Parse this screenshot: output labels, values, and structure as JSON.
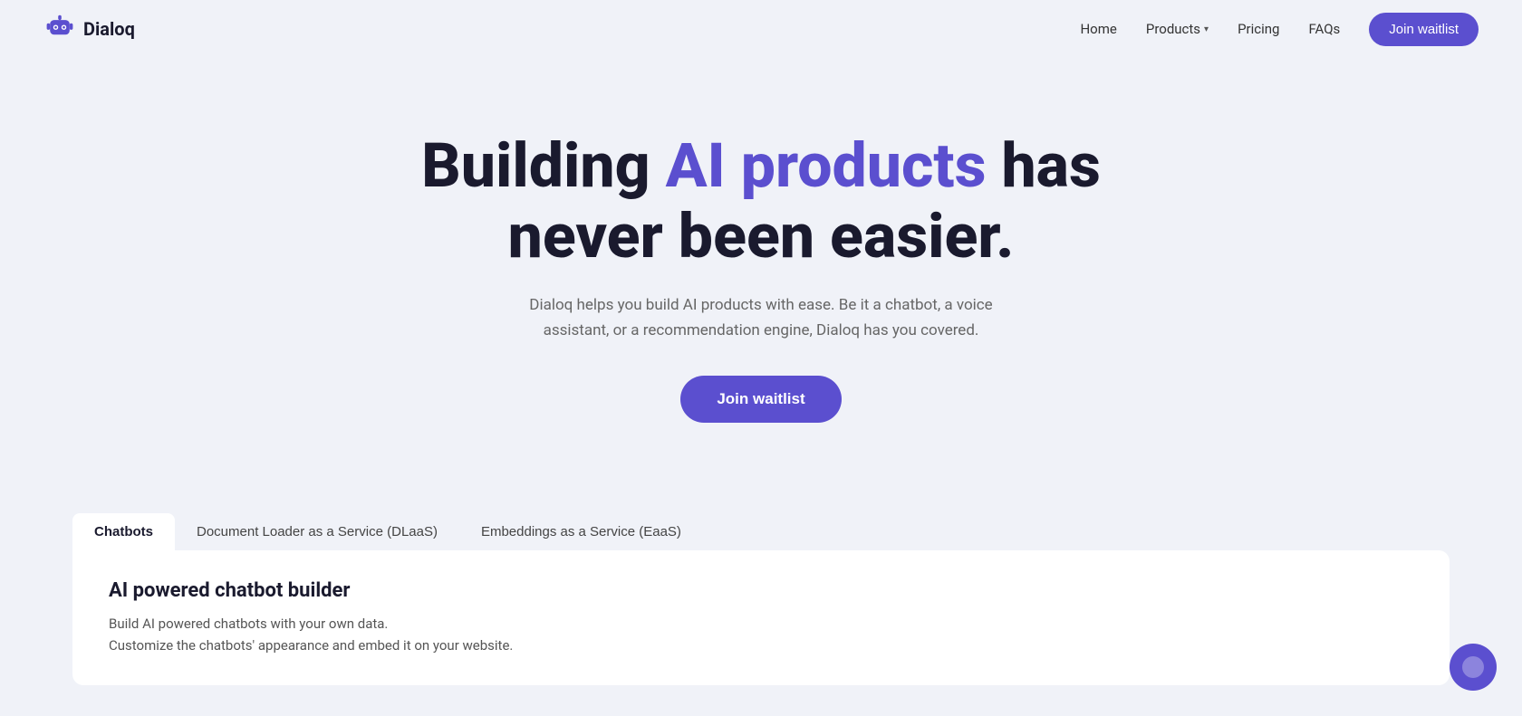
{
  "brand": {
    "name": "Dialoq",
    "logo_alt": "Dialoq robot logo"
  },
  "nav": {
    "home_label": "Home",
    "products_label": "Products",
    "pricing_label": "Pricing",
    "faqs_label": "FAQs",
    "join_btn": "Join waitlist",
    "has_products_dropdown": true
  },
  "hero": {
    "title_part1": "Building ",
    "title_highlight": "AI products",
    "title_part2": " has never been easier.",
    "subtitle": "Dialoq helps you build AI products with ease. Be it a chatbot, a voice assistant, or a recommendation engine, Dialoq has you covered.",
    "join_btn": "Join waitlist"
  },
  "tabs": [
    {
      "id": "chatbots",
      "label": "Chatbots",
      "active": true
    },
    {
      "id": "dlaas",
      "label": "Document Loader as a Service (DLaaS)",
      "active": false
    },
    {
      "id": "eaas",
      "label": "Embeddings as a Service (EaaS)",
      "active": false
    }
  ],
  "panel": {
    "title": "AI powered chatbot builder",
    "description_line1": "Build AI powered chatbots with your own data.",
    "description_line2": "Customize the chatbots' appearance and embed it on your website."
  },
  "colors": {
    "accent": "#5b4fcf",
    "dark": "#1a1a2e",
    "muted": "#666",
    "bg": "#f0f2f8",
    "white": "#ffffff"
  }
}
